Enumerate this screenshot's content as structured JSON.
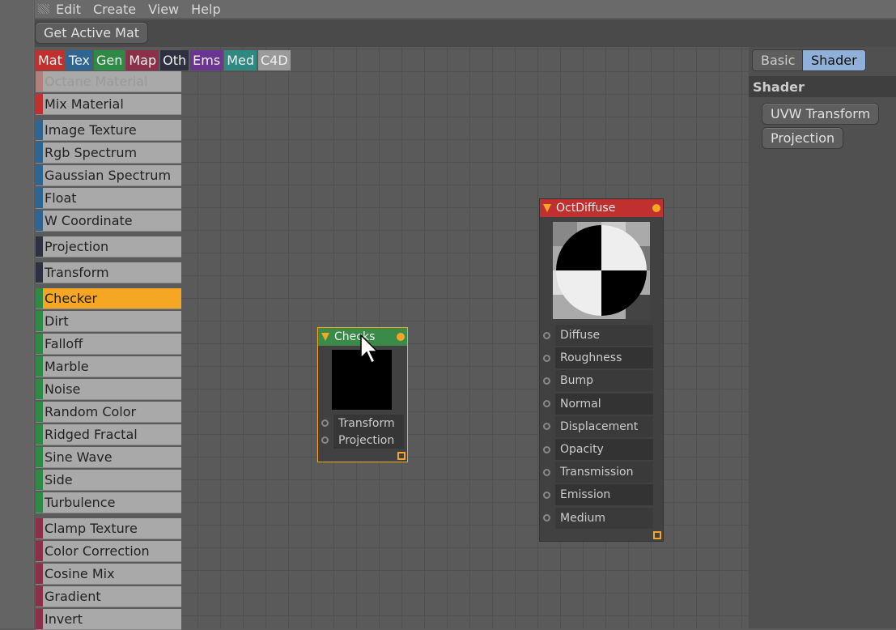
{
  "menu": [
    "Edit",
    "Create",
    "View",
    "Help"
  ],
  "toolbar": {
    "get_active_mat": "Get Active Mat"
  },
  "categories": [
    {
      "label": "Mat",
      "color": "#c0302e"
    },
    {
      "label": "Tex",
      "color": "#2f6590"
    },
    {
      "label": "Gen",
      "color": "#2f8a45"
    },
    {
      "label": "Map",
      "color": "#8a3048"
    },
    {
      "label": "Oth",
      "color": "#2e3140"
    },
    {
      "label": "Ems",
      "color": "#6a3590"
    },
    {
      "label": "Med",
      "color": "#2e8a80"
    },
    {
      "label": "C4D",
      "color": "#9a9a9a"
    }
  ],
  "list_groups": [
    {
      "color": "#c0302e",
      "items": [
        "Octane Material",
        "Mix Material"
      ],
      "disabled": [
        "Octane Material"
      ]
    },
    {
      "color": "#2f6590",
      "items": [
        "Image Texture",
        "Rgb Spectrum",
        "Gaussian Spectrum",
        "Float",
        "W Coordinate"
      ]
    },
    {
      "color": "#2e3140",
      "items": [
        "Projection"
      ]
    },
    {
      "color": "#2e3140",
      "items": [
        "Transform"
      ]
    },
    {
      "color": "#2f8a45",
      "items": [
        "Checker",
        "Dirt",
        "Falloff",
        "Marble",
        "Noise",
        "Random Color",
        "Ridged Fractal",
        "Sine Wave",
        "Side",
        "Turbulence"
      ]
    },
    {
      "color": "#8a3048",
      "items": [
        "Clamp Texture",
        "Color Correction",
        "Cosine Mix",
        "Gradient",
        "Invert"
      ]
    }
  ],
  "selected_item": "Checker",
  "right_panel": {
    "tabs": [
      "Basic",
      "Shader"
    ],
    "active_tab": "Shader",
    "section": "Shader",
    "buttons": [
      "UVW Transform",
      "Projection"
    ]
  },
  "nodes": {
    "checks": {
      "title": "Checks",
      "color": "#3a8a4a",
      "ports": [
        "Transform",
        "Projection"
      ]
    },
    "octdiffuse": {
      "title": "OctDiffuse",
      "color": "#c0302e",
      "ports": [
        "Diffuse",
        "Roughness",
        "Bump",
        "Normal",
        "Displacement",
        "Opacity",
        "Transmission",
        "Emission",
        "Medium"
      ]
    }
  }
}
